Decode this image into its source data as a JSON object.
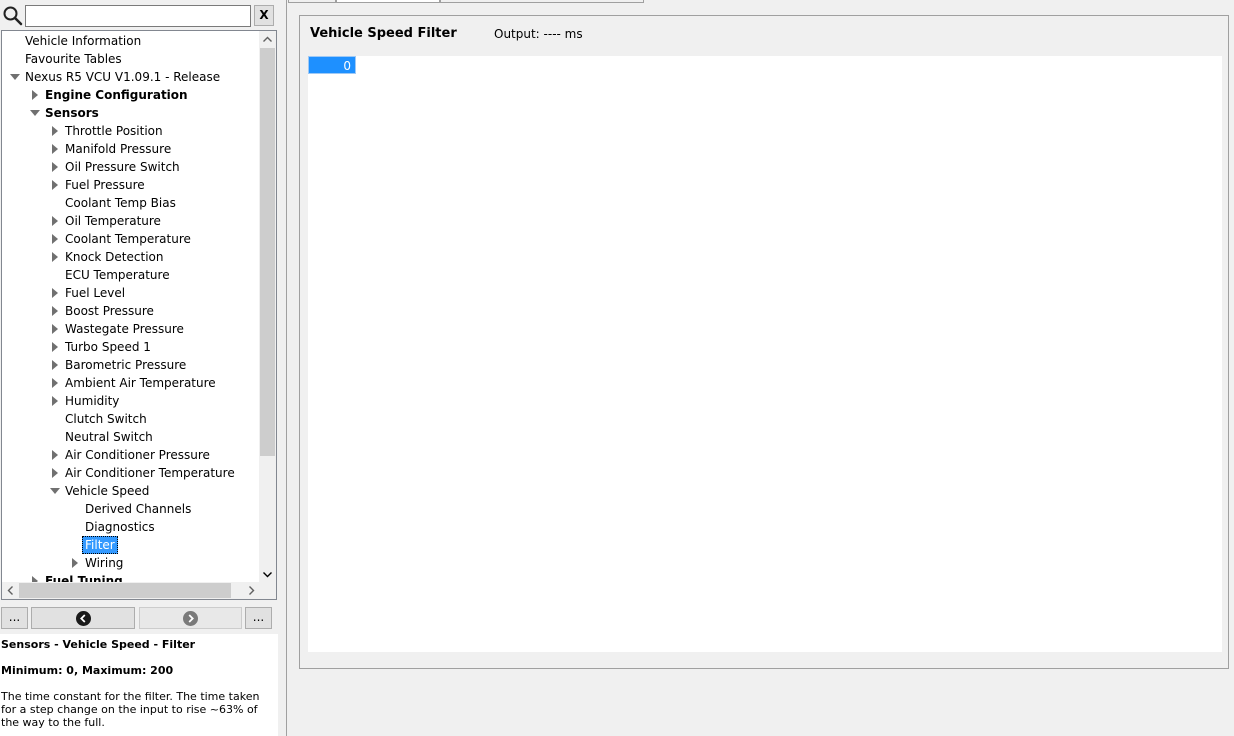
{
  "search": {
    "value": "",
    "placeholder": "",
    "clear_label": "X"
  },
  "tree": [
    {
      "label": "Vehicle Information",
      "level": 0,
      "arrow": "none",
      "bold": false,
      "selected": false
    },
    {
      "label": "Favourite Tables",
      "level": 0,
      "arrow": "none",
      "bold": false,
      "selected": false
    },
    {
      "label": "Nexus R5 VCU V1.09.1 - Release",
      "level": 0,
      "arrow": "down",
      "bold": false,
      "selected": false
    },
    {
      "label": "Engine Configuration",
      "level": 1,
      "arrow": "right",
      "bold": true,
      "selected": false
    },
    {
      "label": "Sensors",
      "level": 1,
      "arrow": "down",
      "bold": true,
      "selected": false
    },
    {
      "label": "Throttle Position",
      "level": 2,
      "arrow": "right",
      "bold": false,
      "selected": false
    },
    {
      "label": "Manifold Pressure",
      "level": 2,
      "arrow": "right",
      "bold": false,
      "selected": false
    },
    {
      "label": "Oil Pressure Switch",
      "level": 2,
      "arrow": "right",
      "bold": false,
      "selected": false
    },
    {
      "label": "Fuel Pressure",
      "level": 2,
      "arrow": "right",
      "bold": false,
      "selected": false
    },
    {
      "label": "Coolant Temp Bias",
      "level": 2,
      "arrow": "none",
      "bold": false,
      "selected": false
    },
    {
      "label": "Oil Temperature",
      "level": 2,
      "arrow": "right",
      "bold": false,
      "selected": false
    },
    {
      "label": "Coolant Temperature",
      "level": 2,
      "arrow": "right",
      "bold": false,
      "selected": false
    },
    {
      "label": "Knock Detection",
      "level": 2,
      "arrow": "right",
      "bold": false,
      "selected": false
    },
    {
      "label": "ECU Temperature",
      "level": 2,
      "arrow": "none",
      "bold": false,
      "selected": false
    },
    {
      "label": "Fuel Level",
      "level": 2,
      "arrow": "right",
      "bold": false,
      "selected": false
    },
    {
      "label": "Boost Pressure",
      "level": 2,
      "arrow": "right",
      "bold": false,
      "selected": false
    },
    {
      "label": "Wastegate Pressure",
      "level": 2,
      "arrow": "right",
      "bold": false,
      "selected": false
    },
    {
      "label": "Turbo Speed 1",
      "level": 2,
      "arrow": "right",
      "bold": false,
      "selected": false
    },
    {
      "label": "Barometric Pressure",
      "level": 2,
      "arrow": "right",
      "bold": false,
      "selected": false
    },
    {
      "label": "Ambient Air Temperature",
      "level": 2,
      "arrow": "right",
      "bold": false,
      "selected": false
    },
    {
      "label": "Humidity",
      "level": 2,
      "arrow": "right",
      "bold": false,
      "selected": false
    },
    {
      "label": "Clutch Switch",
      "level": 2,
      "arrow": "none",
      "bold": false,
      "selected": false
    },
    {
      "label": "Neutral Switch",
      "level": 2,
      "arrow": "none",
      "bold": false,
      "selected": false
    },
    {
      "label": "Air Conditioner Pressure",
      "level": 2,
      "arrow": "right",
      "bold": false,
      "selected": false
    },
    {
      "label": "Air Conditioner Temperature",
      "level": 2,
      "arrow": "right",
      "bold": false,
      "selected": false
    },
    {
      "label": "Vehicle Speed",
      "level": 2,
      "arrow": "down",
      "bold": false,
      "selected": false
    },
    {
      "label": "Derived Channels",
      "level": 3,
      "arrow": "none",
      "bold": false,
      "selected": false
    },
    {
      "label": "Diagnostics",
      "level": 3,
      "arrow": "none",
      "bold": false,
      "selected": false
    },
    {
      "label": "Filter",
      "level": 3,
      "arrow": "none",
      "bold": false,
      "selected": true
    },
    {
      "label": "Wiring",
      "level": 3,
      "arrow": "right",
      "bold": false,
      "selected": false
    },
    {
      "label": "Fuel Tuning",
      "level": 1,
      "arrow": "right",
      "bold": true,
      "selected": false
    }
  ],
  "nav": {
    "more_left_label": "...",
    "more_right_label": "..."
  },
  "help": {
    "title": "Sensors - Vehicle Speed - Filter",
    "range": "Minimum: 0, Maximum: 200",
    "description": "The time constant for the filter.  The time taken for a step change on the input to rise ~63% of the way to the full."
  },
  "table": {
    "title": "Vehicle Speed Filter",
    "output": "Output: ---- ms",
    "value": "0"
  },
  "colors": {
    "selection": "#3399ff",
    "value_cell": "#1e90ff"
  }
}
